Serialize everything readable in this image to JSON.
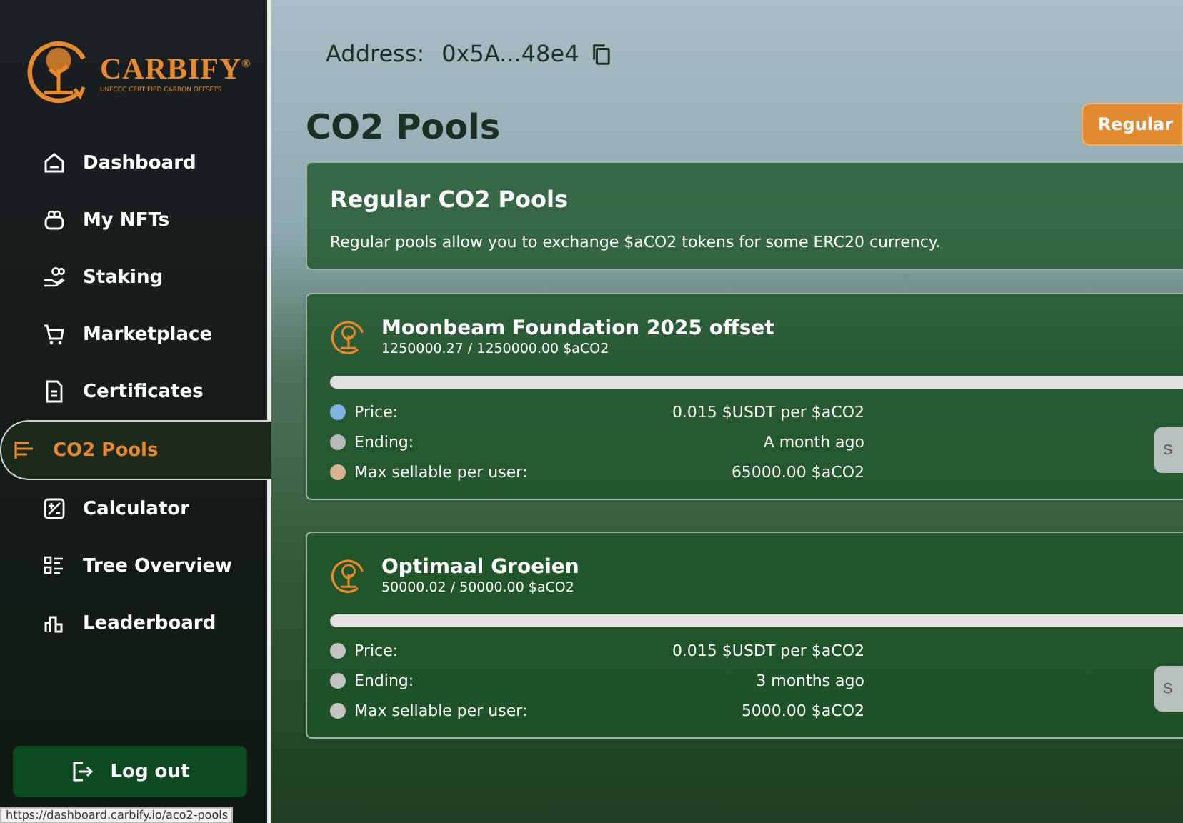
{
  "logo": {
    "name": "CARBIFY",
    "mark": "®",
    "tagline": "UNFCCC CERTIFIED CARBON OFFSETS"
  },
  "sidebar": {
    "items": [
      {
        "label": "Dashboard",
        "selected": false
      },
      {
        "label": "My NFTs",
        "selected": false
      },
      {
        "label": "Staking",
        "selected": false
      },
      {
        "label": "Marketplace",
        "selected": false
      },
      {
        "label": "Certificates",
        "selected": false
      },
      {
        "label": "CO2 Pools",
        "selected": true
      },
      {
        "label": "Calculator",
        "selected": false
      },
      {
        "label": "Tree Overview",
        "selected": false
      },
      {
        "label": "Leaderboard",
        "selected": false
      }
    ],
    "logout": "Log out"
  },
  "header": {
    "address_label": "Address:",
    "address": "0x5A...48e4"
  },
  "page_title": "CO2 Pools",
  "filter_button": "Regular",
  "intro": {
    "title": "Regular CO2 Pools",
    "text": "Regular pools allow you to exchange $aCO2 tokens for some ERC20 currency."
  },
  "pools": [
    {
      "name": "Moonbeam Foundation 2025 offset",
      "amount": "1250000.27 / 1250000.00 $aCO2",
      "level": 1,
      "button": "S",
      "rows": [
        {
          "label": "Price:",
          "value": "0.015 $USDT per $aCO2",
          "color": "#7fb2e0"
        },
        {
          "label": "Ending:",
          "value": "A month ago",
          "color": "#b8b8b8"
        },
        {
          "label": "Max sellable per user:",
          "value": "65000.00 $aCO2",
          "color": "#d8b48e"
        }
      ]
    },
    {
      "name": "Optimaal Groeien",
      "amount": "50000.02 / 50000.00 $aCO2",
      "level": 1,
      "button": "S",
      "rows": [
        {
          "label": "Price:",
          "value": "0.015 $USDT per $aCO2",
          "color": "#c4c4c4"
        },
        {
          "label": "Ending:",
          "value": "3 months ago",
          "color": "#c4c4c4"
        },
        {
          "label": "Max sellable per user:",
          "value": "5000.00 $aCO2",
          "color": "#c4c4c4"
        }
      ]
    }
  ],
  "status_bar": {
    "url": "https://dashboard.carbify.io/aco2-pools"
  }
}
